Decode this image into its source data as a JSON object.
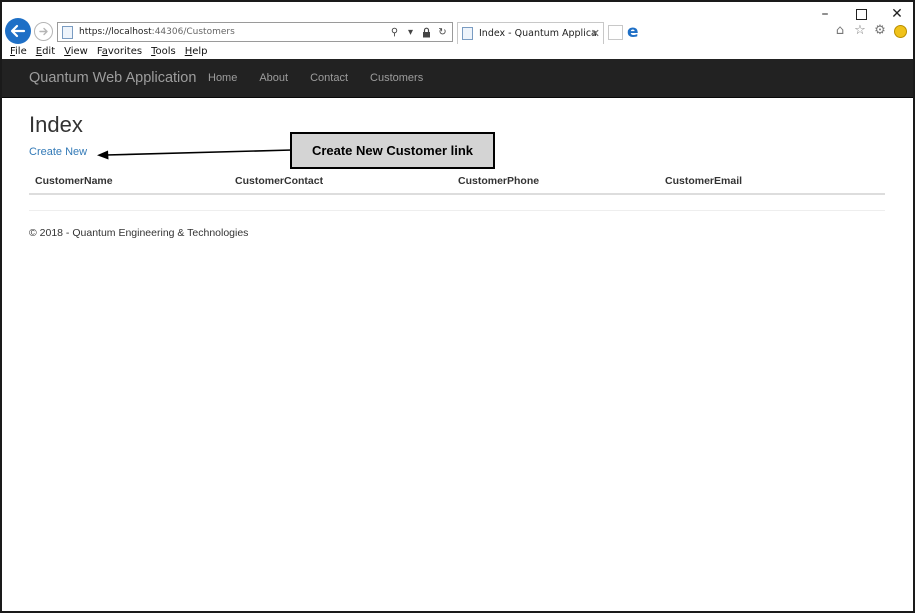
{
  "browser": {
    "url_scheme_host": "https://localhost",
    "url_rest": ":44306/Customers",
    "tab_title": "Index - Quantum Application",
    "window_controls": [
      "minimize-icon",
      "maximize-icon",
      "close-icon"
    ],
    "menu": [
      "File",
      "Edit",
      "View",
      "Favorites",
      "Tools",
      "Help"
    ],
    "menu_underlined": [
      "F",
      "E",
      "V",
      "a",
      "T",
      "H"
    ]
  },
  "navbar": {
    "brand": "Quantum Web Application",
    "links": [
      "Home",
      "About",
      "Contact",
      "Customers"
    ]
  },
  "main": {
    "title": "Index",
    "create_link": "Create New",
    "columns": [
      "CustomerName",
      "CustomerContact",
      "CustomerPhone",
      "CustomerEmail"
    ],
    "rows": []
  },
  "footer": {
    "text": "© 2018 - Quantum Engineering & Technologies"
  },
  "annotation": {
    "label": "Create New Customer link"
  },
  "colors": {
    "navbar_bg": "#222222",
    "nav_text": "#9d9d9d",
    "link": "#337ab7",
    "back_button": "#1e6fc6"
  }
}
